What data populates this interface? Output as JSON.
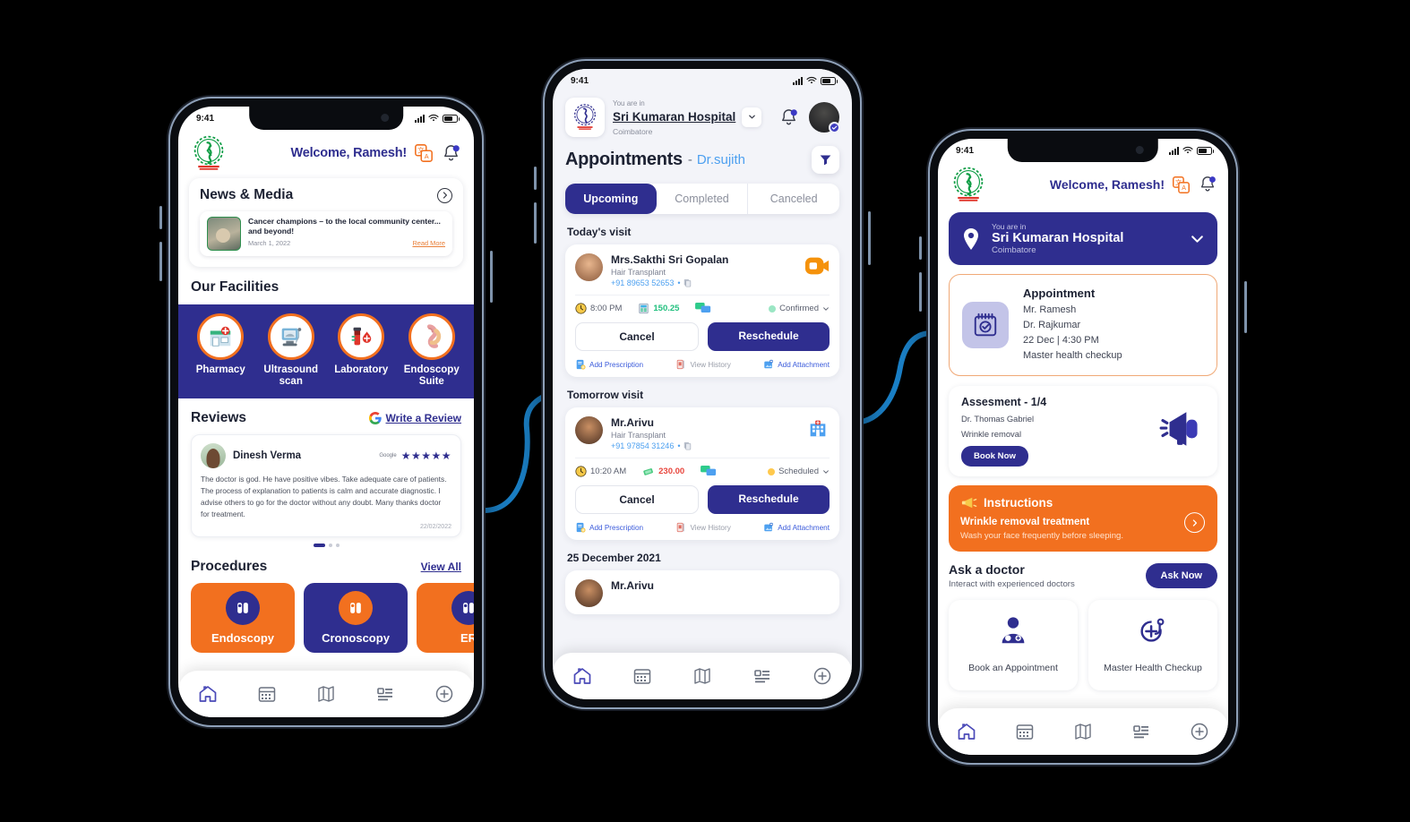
{
  "status_bar": {
    "time": "9:41"
  },
  "phone_left": {
    "header": {
      "welcome": "Welcome, Ramesh!",
      "logo": "hospital-logo",
      "translate_icon": "translate-icon",
      "bell_icon": "bell-icon"
    },
    "news": {
      "title": "News & Media",
      "arrow_icon": "chevron-right-circle-icon",
      "item": {
        "headline": "Cancer champions – to the local community center... and beyond!",
        "date": "March 1, 2022",
        "read_more": "Read More"
      }
    },
    "facilities": {
      "title": "Our Facilities",
      "items": [
        {
          "label": "Pharmacy",
          "icon": "pharmacy-icon"
        },
        {
          "label": "Ultrasound scan",
          "icon": "ultrasound-icon"
        },
        {
          "label": "Laboratory",
          "icon": "laboratory-icon"
        },
        {
          "label": "Endoscopy Suite",
          "icon": "endoscopy-icon"
        }
      ]
    },
    "reviews": {
      "title": "Reviews",
      "write_review": "Write a Review",
      "google_icon": "google-icon",
      "card": {
        "name": "Dinesh Verma",
        "source": "Google",
        "stars": "★★★★★",
        "text": "The doctor is god. He have positive vibes. Take adequate care of patients. The process of explanation to patients is calm and accurate diagnostic. I advise others to go for the doctor without any doubt. Many thanks doctor for treatment.",
        "date": "22/02/2022"
      }
    },
    "procedures": {
      "title": "Procedures",
      "view_all": "View All",
      "items": [
        {
          "label": "Endoscopy",
          "bg": "#f2701f",
          "icon_bg": "#2f2e8f"
        },
        {
          "label": "Cronoscopy",
          "bg": "#2f2e8f",
          "icon_bg": "#f2701f"
        },
        {
          "label": "ER",
          "bg": "#f2701f",
          "icon_bg": "#2f2e8f"
        }
      ]
    },
    "bottom_nav": [
      {
        "icon": "home-icon",
        "active": true
      },
      {
        "icon": "calendar-icon",
        "active": false
      },
      {
        "icon": "map-icon",
        "active": false
      },
      {
        "icon": "list-icon",
        "active": false
      },
      {
        "icon": "plus-circle-icon",
        "active": false
      }
    ]
  },
  "phone_mid": {
    "header": {
      "you_are_in": "You are in",
      "hospital": "Sri Kumaran Hospital",
      "city": "Coimbatore",
      "chevron_icon": "chevron-down-icon",
      "bell_icon": "bell-icon",
      "avatar": "user-avatar"
    },
    "page": {
      "title": "Appointments",
      "separator": "-",
      "doctor": "Dr.sujith",
      "filter_icon": "filter-icon"
    },
    "tabs": [
      {
        "label": "Upcoming",
        "active": true
      },
      {
        "label": "Completed",
        "active": false
      },
      {
        "label": "Canceled",
        "active": false
      }
    ],
    "groups": [
      {
        "label": "Today's visit",
        "appointment": {
          "name": "Mrs.Sakthi Sri Gopalan",
          "treatment": "Hair Transplant",
          "phone": "+91 89653 52653",
          "copy_icon": "copy-icon",
          "channel_icon": "video-call-icon",
          "time": "8:00 PM",
          "time_icon": "clock-icon",
          "amount": "150.25",
          "amount_icon": "payment-icon",
          "chat_icon": "chat-icon",
          "status": "Confirmed",
          "status_color": "#9be6c4",
          "cancel": "Cancel",
          "reschedule": "Reschedule",
          "actions": [
            {
              "label": "Add Prescription",
              "icon": "prescription-icon",
              "muted": false
            },
            {
              "label": "View History",
              "icon": "history-icon",
              "muted": true
            },
            {
              "label": "Add Attachment",
              "icon": "attachment-icon",
              "muted": false
            }
          ]
        }
      },
      {
        "label": "Tomorrow visit",
        "appointment": {
          "name": "Mr.Arivu",
          "treatment": "Hair Transplant",
          "phone": "+91 97854 31246",
          "copy_icon": "copy-icon",
          "channel_icon": "hospital-visit-icon",
          "time": "10:20 AM",
          "time_icon": "clock-icon",
          "amount": "230.00",
          "amount_icon": "cash-icon",
          "chat_icon": "chat-icon",
          "status": "Scheduled",
          "status_color": "#ffc94d",
          "cancel": "Cancel",
          "reschedule": "Reschedule",
          "actions": [
            {
              "label": "Add Prescription",
              "icon": "prescription-icon",
              "muted": false
            },
            {
              "label": "View History",
              "icon": "history-icon",
              "muted": true
            },
            {
              "label": "Add Attachment",
              "icon": "attachment-icon",
              "muted": false
            }
          ]
        }
      }
    ],
    "next_group": {
      "label": "25 December 2021",
      "name": "Mr.Arivu"
    },
    "bottom_nav": [
      {
        "icon": "home-icon",
        "active": true
      },
      {
        "icon": "calendar-icon",
        "active": false
      },
      {
        "icon": "map-icon",
        "active": false
      },
      {
        "icon": "list-icon",
        "active": false
      },
      {
        "icon": "plus-circle-icon",
        "active": false
      }
    ]
  },
  "phone_right": {
    "header": {
      "welcome": "Welcome, Ramesh!",
      "logo": "hospital-logo",
      "translate_icon": "translate-icon",
      "bell_icon": "bell-icon"
    },
    "location": {
      "you_are_in": "You are in",
      "hospital": "Sri Kumaran Hospital",
      "city": "Coimbatore",
      "pin_icon": "location-pin-icon",
      "chevron_icon": "chevron-down-icon"
    },
    "appointment": {
      "title": "Appointment",
      "patient": "Mr. Ramesh",
      "doctor": "Dr. Rajkumar",
      "datetime": "22 Dec | 4:30 PM",
      "service": "Master health checkup",
      "icon": "calendar-check-icon"
    },
    "assessment": {
      "title": "Assesment - 1/4",
      "doctor": "Dr. Thomas Gabriel",
      "topic": "Wrinkle removal",
      "button": "Book Now",
      "icon": "megaphone-icon"
    },
    "instructions": {
      "title": "Instructions",
      "icon": "announcement-icon",
      "line1": "Wrinkle removal treatment",
      "line2": "Wash your face frequently before sleeping.",
      "arrow_icon": "chevron-right-circle-icon"
    },
    "ask_doctor": {
      "title": "Ask a doctor",
      "subtitle": "Interact with experienced doctors",
      "button": "Ask Now"
    },
    "tiles": [
      {
        "label": "Book an Appointment",
        "icon": "doctor-icon"
      },
      {
        "label": "Master Health Checkup",
        "icon": "stethoscope-plus-icon"
      }
    ],
    "bottom_nav": [
      {
        "icon": "home-icon",
        "active": true
      },
      {
        "icon": "calendar-icon",
        "active": false
      },
      {
        "icon": "map-icon",
        "active": false
      },
      {
        "icon": "list-icon",
        "active": false
      },
      {
        "icon": "plus-circle-icon",
        "active": false
      }
    ]
  },
  "colors": {
    "navy": "#2f2e8f",
    "orange": "#f2701f",
    "connector_blue": "#1b82c9",
    "link_blue": "#4da0f0"
  }
}
